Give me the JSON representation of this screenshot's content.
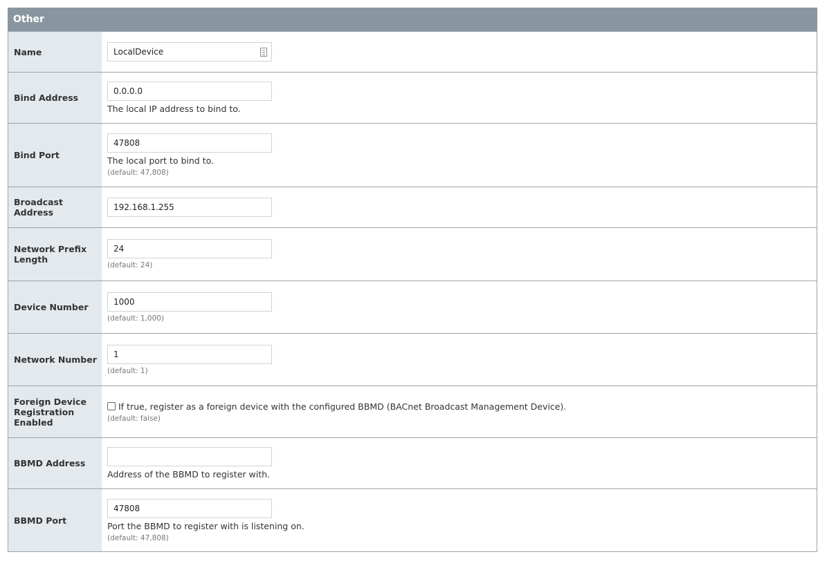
{
  "section": {
    "title": "Other"
  },
  "fields": {
    "name": {
      "label": "Name",
      "value": "LocalDevice"
    },
    "bind_address": {
      "label": "Bind Address",
      "value": "0.0.0.0",
      "description": "The local IP address to bind to."
    },
    "bind_port": {
      "label": "Bind Port",
      "value": "47808",
      "description": "The local port to bind to.",
      "default": "(default: 47,808)"
    },
    "broadcast_address": {
      "label": "Broadcast Address",
      "value": "192.168.1.255"
    },
    "network_prefix_length": {
      "label": "Network Prefix Length",
      "value": "24",
      "default": "(default: 24)"
    },
    "device_number": {
      "label": "Device Number",
      "value": "1000",
      "default": "(default: 1,000)"
    },
    "network_number": {
      "label": "Network Number",
      "value": "1",
      "default": "(default: 1)"
    },
    "foreign_device": {
      "label": "Foreign Device Registration Enabled",
      "checked": false,
      "description": "If true, register as a foreign device with the configured BBMD (BACnet Broadcast Management Device).",
      "default": "(default: false)"
    },
    "bbmd_address": {
      "label": "BBMD Address",
      "value": "",
      "description": "Address of the BBMD to register with."
    },
    "bbmd_port": {
      "label": "BBMD Port",
      "value": "47808",
      "description": "Port the BBMD to register with is listening on.",
      "default": "(default: 47,808)"
    }
  },
  "icons": {
    "name_field": "note-icon"
  },
  "colors": {
    "header": "#8a969f",
    "label_bg": "#e4e9ee",
    "border": "#9aa3aa"
  }
}
